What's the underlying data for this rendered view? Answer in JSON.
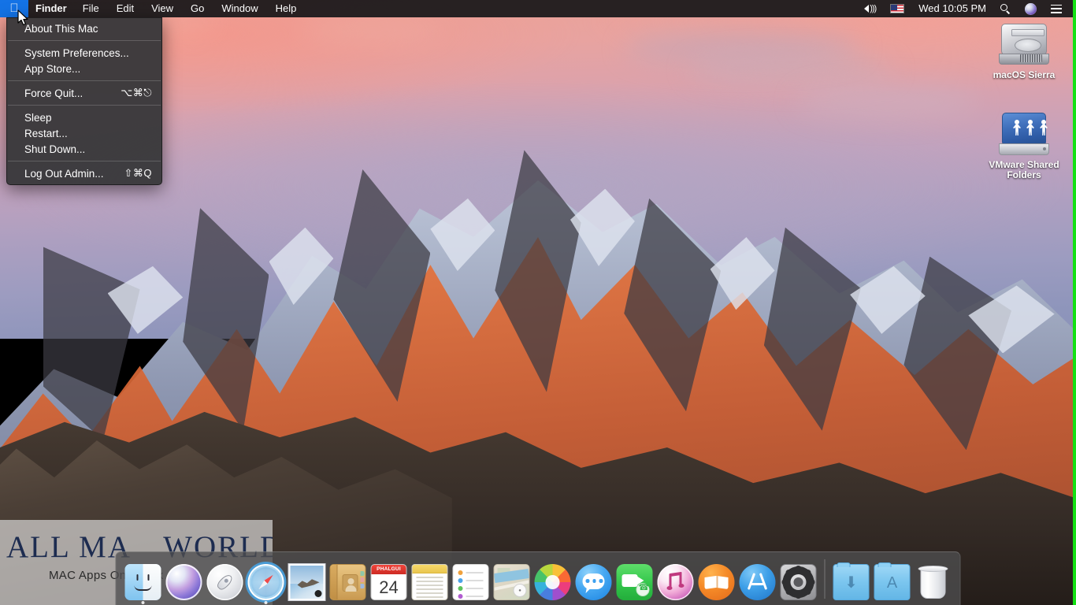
{
  "menubar": {
    "apple_logo": "apple-logo-icon",
    "items": [
      {
        "label": "Finder",
        "active": true
      },
      {
        "label": "File",
        "active": false
      },
      {
        "label": "Edit",
        "active": false
      },
      {
        "label": "View",
        "active": false
      },
      {
        "label": "Go",
        "active": false
      },
      {
        "label": "Window",
        "active": false
      },
      {
        "label": "Help",
        "active": false
      }
    ],
    "status": {
      "volume_icon": "volume-speaker-icon",
      "input_source_icon": "us-flag-icon",
      "clock": "Wed 10:05 PM",
      "spotlight_icon": "search-icon",
      "siri_icon": "siri-icon",
      "notification_center_icon": "notification-center-icon"
    },
    "highlight_color": "#1473e6",
    "background_color": "#161618"
  },
  "apple_menu": {
    "groups": [
      [
        {
          "label": "About This Mac",
          "shortcut": ""
        }
      ],
      [
        {
          "label": "System Preferences...",
          "shortcut": ""
        },
        {
          "label": "App Store...",
          "shortcut": ""
        }
      ],
      [
        {
          "label": "Force Quit...",
          "shortcut": "⌥⌘⎋"
        }
      ],
      [
        {
          "label": "Sleep",
          "shortcut": ""
        },
        {
          "label": "Restart...",
          "shortcut": ""
        },
        {
          "label": "Shut Down...",
          "shortcut": ""
        }
      ],
      [
        {
          "label": "Log Out Admin...",
          "shortcut": "⇧⌘Q"
        }
      ]
    ]
  },
  "desktop_icons": [
    {
      "name": "macOS Sierra",
      "type": "hard-drive"
    },
    {
      "name": "VMware Shared Folders",
      "type": "network-drive"
    }
  ],
  "watermark": {
    "title_a": "ALL MA",
    "title_apple": "",
    "title_b": " WORLD",
    "subtitle": "MAC Apps One Click Away"
  },
  "dock": {
    "items": [
      {
        "name": "Finder",
        "icon": "finder-icon",
        "running": true
      },
      {
        "name": "Siri",
        "icon": "siri-icon",
        "running": false
      },
      {
        "name": "Launchpad",
        "icon": "launchpad-icon",
        "running": false
      },
      {
        "name": "Safari",
        "icon": "safari-icon",
        "running": true
      },
      {
        "name": "Mail",
        "icon": "mail-icon",
        "running": false
      },
      {
        "name": "Contacts",
        "icon": "contacts-icon",
        "running": false
      },
      {
        "name": "Calendar",
        "icon": "calendar-icon",
        "running": false
      },
      {
        "name": "Notes",
        "icon": "notes-icon",
        "running": false
      },
      {
        "name": "Reminders",
        "icon": "reminders-icon",
        "running": false
      },
      {
        "name": "Maps",
        "icon": "maps-icon",
        "running": false
      },
      {
        "name": "Photos",
        "icon": "photos-icon",
        "running": false
      },
      {
        "name": "Messages",
        "icon": "messages-icon",
        "running": false
      },
      {
        "name": "FaceTime",
        "icon": "facetime-icon",
        "running": false
      },
      {
        "name": "iTunes",
        "icon": "itunes-icon",
        "running": false
      },
      {
        "name": "iBooks",
        "icon": "ibooks-icon",
        "running": false
      },
      {
        "name": "App Store",
        "icon": "app-store-icon",
        "running": false
      },
      {
        "name": "System Preferences",
        "icon": "system-preferences-icon",
        "running": false
      }
    ],
    "folders": [
      {
        "name": "Downloads",
        "icon": "downloads-folder-icon",
        "glyph": "⬇"
      },
      {
        "name": "Applications",
        "icon": "applications-folder-icon",
        "glyph": "A"
      }
    ],
    "trash": {
      "name": "Trash",
      "icon": "trash-icon"
    }
  },
  "calendar_icon": {
    "month": "PHALGUI",
    "day": "24"
  },
  "vm_border_color": "#14e014"
}
